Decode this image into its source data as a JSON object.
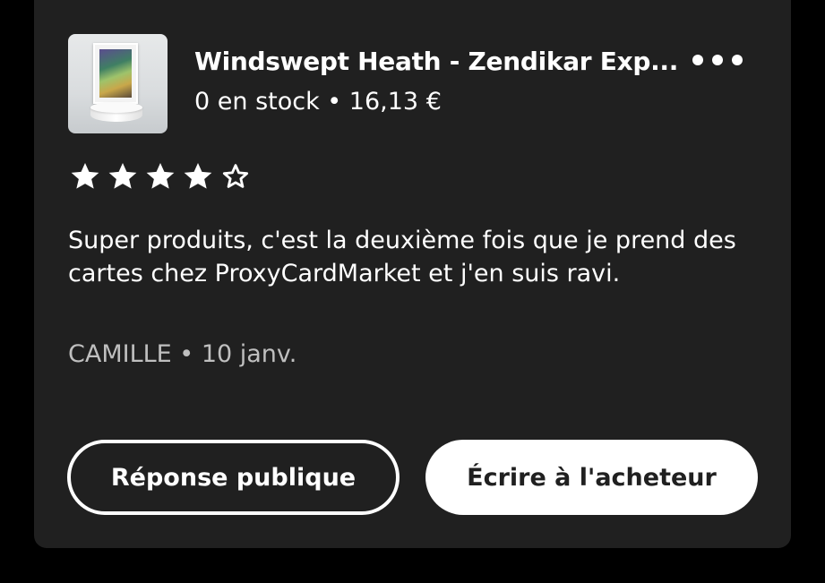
{
  "product": {
    "title": "Windswept Heath - Zendikar Exp...",
    "stock_price": "0 en stock • 16,13 €",
    "thumbnail_icon": "card-on-pedestal-image"
  },
  "menu": {
    "icon": "more-options-icon"
  },
  "rating": {
    "value": 4,
    "max": 5
  },
  "review": {
    "text": "Super produits, c'est la deuxième fois que je prend des cartes chez ProxyCardMarket et j'en suis ravi.",
    "meta": "CAMILLE • 10 janv."
  },
  "actions": {
    "public_reply_label": "Réponse publique",
    "write_buyer_label": "Écrire à l'acheteur"
  },
  "colors": {
    "background": "#000000",
    "card": "#202020",
    "text": "#ffffff",
    "muted_text": "#bfbfbf"
  }
}
